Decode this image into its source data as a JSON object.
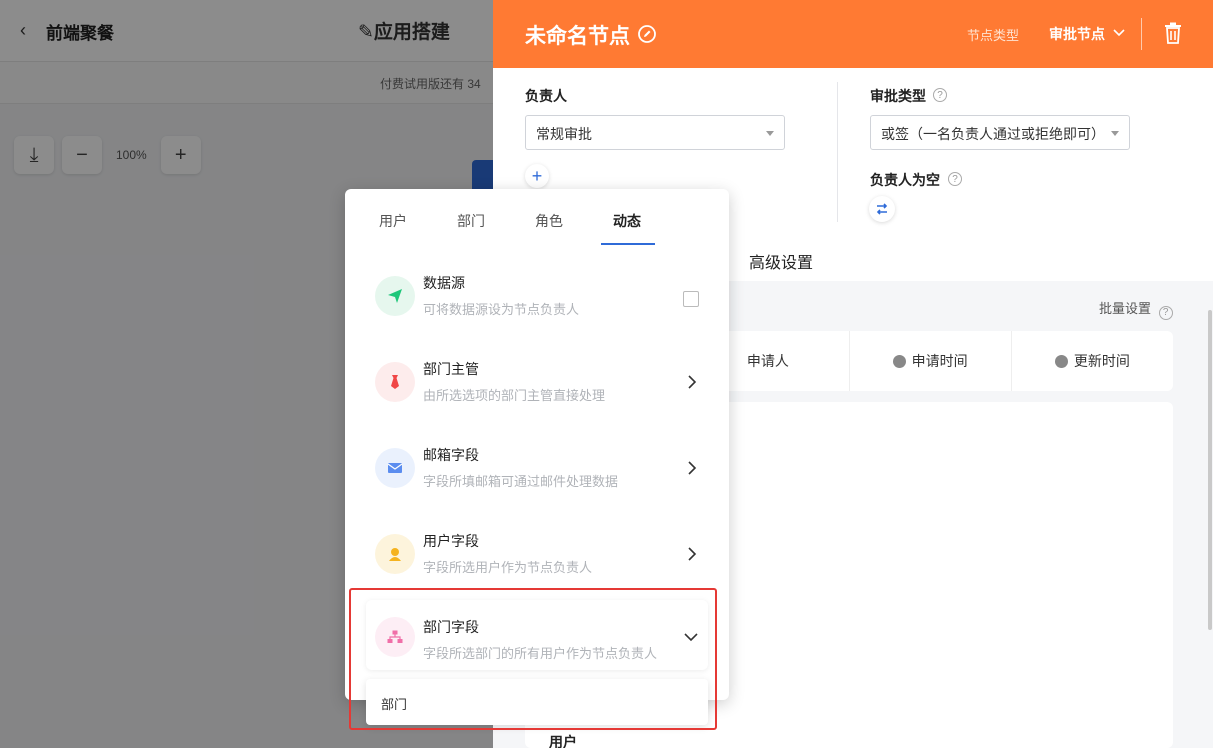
{
  "background": {
    "back_arrow": "‹",
    "app_name": "前端聚餐",
    "build_label": "应用搭建",
    "trial_text": "付费试用版还有 34",
    "zoom": "100%"
  },
  "drawer": {
    "node_title": "未命名节点",
    "node_type_label": "节点类型",
    "node_type_value": "审批节点",
    "assignee_label": "负责人",
    "assignee_select": "常规审批",
    "approval_type_label": "审批类型",
    "approval_type_select": "或签（一名负责人通过或拒绝即可）",
    "empty_assignee_label": "负责人为空",
    "advanced_tab": "高级设置",
    "batch_set": "批量设置",
    "fields": [
      "申请人",
      "申请时间",
      "更新时间"
    ],
    "user_section": "用户"
  },
  "popover": {
    "tabs": [
      "用户",
      "部门",
      "角色",
      "动态"
    ],
    "active_tab": "动态",
    "options": [
      {
        "title": "数据源",
        "desc": "可将数据源设为节点负责人",
        "icon": "send-icon",
        "control": "checkbox"
      },
      {
        "title": "部门主管",
        "desc": "由所选选项的部门主管直接处理",
        "icon": "tie-icon",
        "control": "chevron-right"
      },
      {
        "title": "邮箱字段",
        "desc": "字段所填邮箱可通过邮件处理数据",
        "icon": "mail-icon",
        "control": "chevron-right"
      },
      {
        "title": "用户字段",
        "desc": "字段所选用户作为节点负责人",
        "icon": "user-icon",
        "control": "chevron-right"
      },
      {
        "title": "部门字段",
        "desc": "字段所选部门的所有用户作为节点负责人",
        "icon": "org-icon",
        "control": "chevron-down"
      }
    ],
    "dept_subitem": "部门"
  },
  "colors": {
    "header_orange": "#ff7a33",
    "accent_blue": "#2f6bd8",
    "highlight_red": "#e53935"
  }
}
